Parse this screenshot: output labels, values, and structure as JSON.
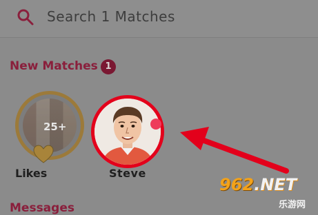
{
  "search": {
    "placeholder": "Search 1 Matches",
    "icon": "search-icon"
  },
  "new_matches": {
    "title": "New Matches",
    "badge_count": "1"
  },
  "matches": [
    {
      "label": "Likes",
      "count_text": "25+",
      "icon": "heart-icon"
    },
    {
      "label": "Steve",
      "online": true
    }
  ],
  "messages": {
    "title": "Messages"
  },
  "watermark": {
    "brand_num": "962",
    "brand_suffix": ".NET",
    "subtitle": "乐游网"
  },
  "colors": {
    "accent": "#8a1f3c",
    "highlight_ring": "#e3001b",
    "likes_ring": "#9c7a3a",
    "online_dot": "#ee3d5b"
  }
}
